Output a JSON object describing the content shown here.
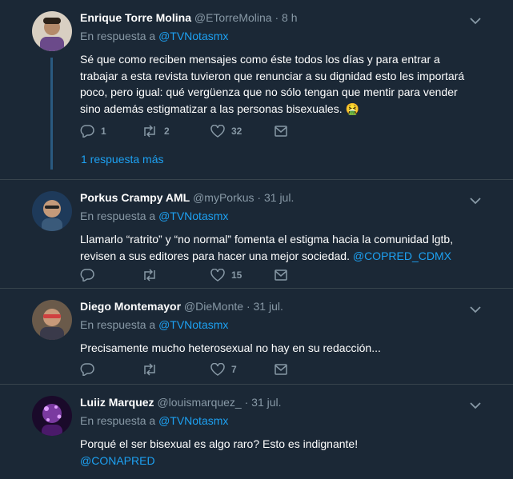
{
  "tweets": [
    {
      "name": "Enrique Torre Molina",
      "handle": "@ETorreMolina",
      "dot": "·",
      "time": "8 h",
      "reply_prefix": "En respuesta a ",
      "reply_to": "@TVNotasmx",
      "text": "Sé que como reciben mensajes como éste todos los días y para entrar a trabajar a esta revista tuvieron que renunciar a su dignidad esto les importará poco, pero igual: qué vergüenza que no sólo tengan que mentir para vender sino además estigmatizar a las personas bisexuales. 🤮",
      "replies": "1",
      "retweets": "2",
      "likes": "32",
      "more_replies": "1 respuesta más",
      "avatar_color": "#c7b9a8"
    },
    {
      "name": "Porkus Crampy AML",
      "handle": "@myPorkus",
      "dot": "·",
      "time": "31 jul.",
      "reply_prefix": "En respuesta a ",
      "reply_to": "@TVNotasmx",
      "text": "Llamarlo “ratrito” y “no normal” fomenta el estigma hacia la comunidad lgtb, revisen a sus editores para hacer una mejor sociedad.",
      "text_mention": "@COPRED_CDMX",
      "replies": "",
      "retweets": "",
      "likes": "15",
      "avatar_color": "#2f4f6f"
    },
    {
      "name": "Diego Montemayor",
      "handle": "@DieMonte",
      "dot": "·",
      "time": "31 jul.",
      "reply_prefix": "En respuesta a ",
      "reply_to": "@TVNotasmx",
      "text": "Precisamente mucho heterosexual no hay en su redacción...",
      "replies": "",
      "retweets": "",
      "likes": "7",
      "avatar_color": "#8a6a5a"
    },
    {
      "name": "Luiiz Marquez",
      "handle": "@louismarquez_",
      "dot": "·",
      "time": "31 jul.",
      "reply_prefix": "En respuesta a ",
      "reply_to": "@TVNotasmx",
      "text": "Porqué el ser bisexual es algo raro? Esto es indignante!",
      "text_mention": "@CONAPRED",
      "avatar_color": "#2a0f3a"
    }
  ],
  "colors": {
    "background": "#1b2836",
    "link": "#1da1f2",
    "muted": "#8899a6",
    "divider": "#38444d"
  },
  "icons": [
    "reply-icon",
    "retweet-icon",
    "like-icon",
    "dm-icon",
    "chevron-down-icon"
  ]
}
